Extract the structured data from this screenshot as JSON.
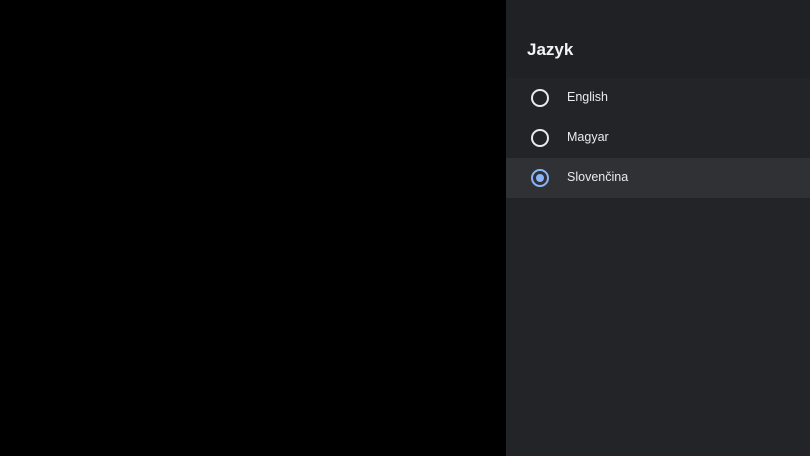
{
  "panel": {
    "title": "Jazyk"
  },
  "language_options": [
    {
      "label": "English",
      "selected": false
    },
    {
      "label": "Magyar",
      "selected": false
    },
    {
      "label": "Slovenčina",
      "selected": true
    }
  ],
  "colors": {
    "background": "#000000",
    "panel": "#232427",
    "header": "#202124",
    "focused_row": "#303134",
    "accent": "#8ab4f8",
    "text": "#e8eaed"
  }
}
